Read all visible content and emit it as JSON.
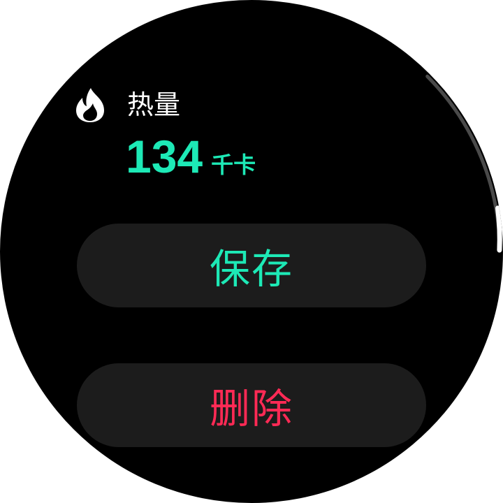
{
  "metric": {
    "icon": "flame-icon",
    "label": "热量",
    "value": "134",
    "unit": "千卡"
  },
  "actions": {
    "save_label": "保存",
    "delete_label": "删除"
  },
  "scroll": {
    "position_fraction": 0.9
  },
  "colors": {
    "background": "#000000",
    "accent": "#1de9b6",
    "danger": "#ff2a55",
    "button_bg": "#1c1c1c",
    "label_text": "#ffffff",
    "scroll_track": "#4a4a4a",
    "scroll_thumb": "#ffffff"
  }
}
